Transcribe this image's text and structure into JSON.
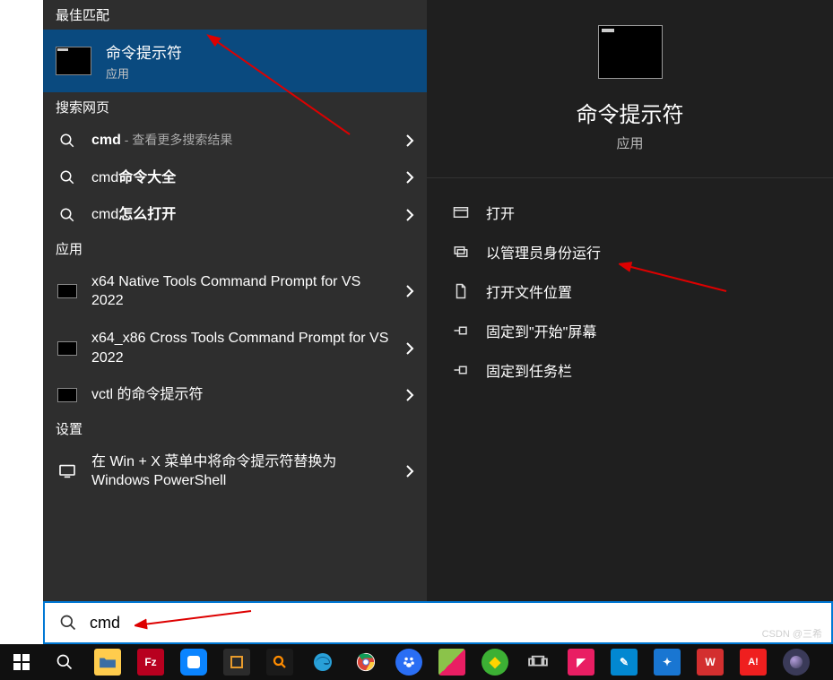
{
  "sections": {
    "best_match": "最佳匹配",
    "web": "搜索网页",
    "apps": "应用",
    "settings": "设置"
  },
  "best_match_item": {
    "title": "命令提示符",
    "subtitle": "应用"
  },
  "web_results": [
    {
      "prefix": "cmd",
      "suffix": " - 查看更多搜索结果"
    },
    {
      "prefix": "cmd",
      "suffix": "命令大全"
    },
    {
      "prefix": "cmd",
      "suffix": "怎么打开"
    }
  ],
  "app_results": [
    {
      "label": "x64 Native Tools Command Prompt for VS 2022"
    },
    {
      "label": "x64_x86 Cross Tools Command Prompt for VS 2022"
    },
    {
      "label": "vctl 的命令提示符"
    }
  ],
  "settings_results": [
    {
      "label": "在 Win + X 菜单中将命令提示符替换为 Windows PowerShell"
    }
  ],
  "detail": {
    "title": "命令提示符",
    "subtitle": "应用"
  },
  "actions": {
    "open": "打开",
    "run_admin": "以管理员身份运行",
    "open_location": "打开文件位置",
    "pin_start": "固定到\"开始\"屏幕",
    "pin_taskbar": "固定到任务栏"
  },
  "search_value": "cmd",
  "taskbar": {
    "items": [
      {
        "name": "start",
        "bg": "transparent",
        "fg": "#fff"
      },
      {
        "name": "search",
        "bg": "transparent",
        "fg": "#fff"
      },
      {
        "name": "explorer",
        "bg": "#ffcc4d",
        "fg": "#3a6ea5"
      },
      {
        "name": "filezilla",
        "bg": "#b8001f",
        "fg": "#fff",
        "txt": "Fz"
      },
      {
        "name": "app-blue",
        "bg": "#0a84ff",
        "fg": "#fff"
      },
      {
        "name": "vscode",
        "bg": "#2b2b2b",
        "fg": "#e89b2c"
      },
      {
        "name": "everything",
        "bg": "#1a1a1a",
        "fg": "#ff8c00"
      },
      {
        "name": "edge",
        "bg": "transparent",
        "fg": "#29a0d8"
      },
      {
        "name": "chrome",
        "bg": "transparent",
        "fg": "#fff"
      },
      {
        "name": "baidu",
        "bg": "#2a6ef4",
        "fg": "#fff"
      },
      {
        "name": "app-box",
        "bg": "#8bc34a",
        "fg": "#fff"
      },
      {
        "name": "360",
        "bg": "#3cb034",
        "fg": "#ffd400"
      },
      {
        "name": "taskview",
        "bg": "transparent",
        "fg": "#ccc"
      },
      {
        "name": "app-pink",
        "bg": "#e91e63",
        "fg": "#fff"
      },
      {
        "name": "app-teal",
        "bg": "#0288d1",
        "fg": "#fff"
      },
      {
        "name": "app-blue2",
        "bg": "#1976d2",
        "fg": "#fff"
      },
      {
        "name": "wps",
        "bg": "#d32f2f",
        "fg": "#fff",
        "txt": "W"
      },
      {
        "name": "anydesk",
        "bg": "#ef1f1f",
        "fg": "#fff",
        "txt": "A!"
      },
      {
        "name": "eclipse",
        "bg": "#3a3a58",
        "fg": "#b39ddb"
      }
    ]
  },
  "watermark": "CSDN @三希"
}
